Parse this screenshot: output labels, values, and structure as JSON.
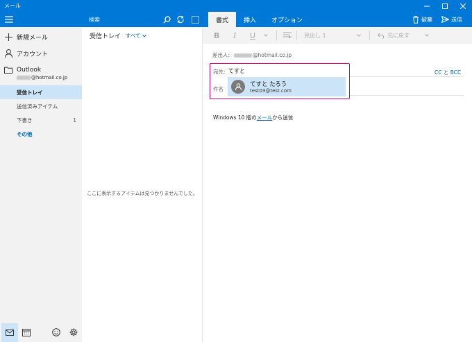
{
  "window": {
    "title": "メール"
  },
  "topbar": {
    "search_placeholder": "検索",
    "tabs": [
      {
        "label": "書式",
        "active": true
      },
      {
        "label": "挿入",
        "active": false
      },
      {
        "label": "オプション",
        "active": false
      }
    ],
    "discard_label": "破棄",
    "send_label": "送信",
    "accent_color": "#0078d7"
  },
  "sidebar": {
    "new_mail_label": "新規メール",
    "account_label": "アカウント",
    "account_name": "Outlook",
    "account_email_suffix": "@hotmail.co.jp",
    "folders": [
      {
        "label": "受信トレイ",
        "count": "",
        "active": true
      },
      {
        "label": "送信済みアイテム",
        "count": "",
        "active": false
      },
      {
        "label": "下書き",
        "count": "1",
        "active": false
      }
    ],
    "more_label": "その他",
    "selected_color": "#cce4f7"
  },
  "list": {
    "title": "受信トレイ",
    "filter_label": "すべて",
    "empty_message": "ここに表示するアイテムは見つかりませんでした。"
  },
  "compose": {
    "format_buttons": [
      "B",
      "I",
      "U"
    ],
    "heading_style": "見出し 1",
    "undo_label": "元に戻す",
    "from_label": "差出人:",
    "from_email_suffix": "@hotmail.co.jp",
    "to_label": "宛先:",
    "to_value": "てすと",
    "subject_label": "件名",
    "suggestion": {
      "name": "てすと たろう",
      "email": "test03@test.com"
    },
    "cc_bcc_label": "CC と BCC",
    "body_prefix": "Windows 10 版の",
    "body_link": "メール",
    "body_suffix": "から送信",
    "highlight_color": "#d80073"
  }
}
